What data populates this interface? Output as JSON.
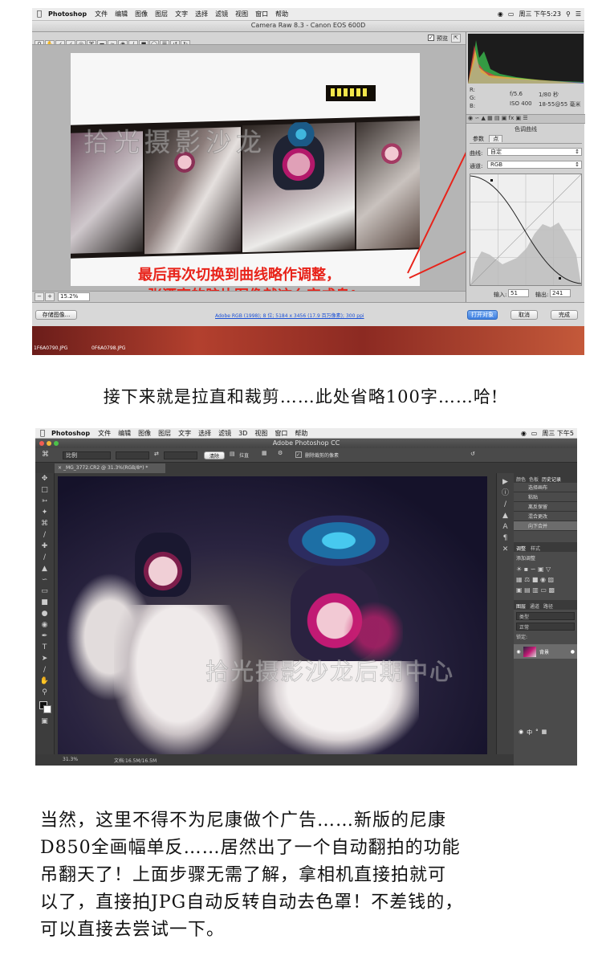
{
  "screenshot1": {
    "menubar": {
      "app": "Photoshop",
      "items": [
        "文件",
        "编辑",
        "图像",
        "图层",
        "文字",
        "选择",
        "滤镜",
        "视图",
        "窗口",
        "帮助"
      ],
      "status": "周三 下午5:23"
    },
    "window_title": "Camera Raw 8.3 - Canon EOS 600D",
    "preview_label": "预览",
    "zoom": "15.2%",
    "watermark": "拾光摄影沙龙",
    "annotation_line1": "最后再次切换到曲线略作调整，",
    "annotation_line2": "一张漂亮的胶片图像就这么完成鸟!",
    "camera_info": {
      "r_label": "R:",
      "g_label": "G:",
      "b_label": "B:",
      "aperture": "f/5.6",
      "shutter": "1/80 秒",
      "iso": "ISO 400",
      "lens": "18-55@55 毫米"
    },
    "panel_title": "色调曲线",
    "curve_tabs": [
      "参数",
      "点"
    ],
    "curve_label": "曲线:",
    "curve_value": "自定",
    "channel_label": "通道:",
    "channel_value": "RGB",
    "input_label": "输入:",
    "input_value": "51",
    "output_label": "输出:",
    "output_value": "241",
    "save_button": "存储图像...",
    "workflow_link": "Adobe RGB (1998); 8 位; 5184 x 3456 (17.9 百万像素); 300 ppi",
    "open_button": "打开对象",
    "cancel_button": "取消",
    "done_button": "完成",
    "dock_files": [
      "1F6A0790.JPG",
      "0F6A0798.JPG"
    ]
  },
  "paragraph1": "接下来就是拉直和裁剪……此处省略100字……哈!",
  "screenshot2": {
    "menubar": {
      "app": "Photoshop",
      "items": [
        "文件",
        "编辑",
        "图像",
        "图层",
        "文字",
        "选择",
        "滤镜",
        "3D",
        "视图",
        "窗口",
        "帮助"
      ],
      "status": "周三 下午5"
    },
    "window_title": "Adobe Photoshop CC",
    "options": {
      "ratio": "比例",
      "clear_button": "清除",
      "straighten": "拉直",
      "delete_crop": "删除裁剪的像素"
    },
    "doc_tab": "_MG_3772.CR2 @ 31.3%(RGB/8*) *",
    "watermark": "拾光摄影沙龙后期中心",
    "status_zoom": "31.3%",
    "status_doc": "文档:16.5M/16.5M",
    "panel_tabs": [
      "颜色",
      "色板",
      "历史记录"
    ],
    "history_items": [
      "选择画布",
      "粘贴",
      "离反保留",
      "混合更改",
      "向下合并"
    ],
    "adjust_tabs": [
      "调整",
      "样式"
    ],
    "adjust_title": "添加调整",
    "layer_tabs": [
      "图层",
      "通道",
      "路径"
    ],
    "layer_kind": "类型",
    "layer_blend": "正常",
    "layer_lock": "锁定:",
    "layer_name": "背景",
    "ime": "中"
  },
  "paragraph2": [
    "当然，这里不得不为尼康做个广告……新版的尼康",
    "D850全画幅单反……居然出了一个自动翻拍的功能",
    "吊翻天了！上面步骤无需了解，拿相机直接拍就可",
    "以了，直接拍JPG自动反转自动去色罩！不差钱的，",
    "可以直接去尝试一下。"
  ],
  "colors": {
    "annotation_red": "#e8231a",
    "ps_dark": "#3a3a3a",
    "acr_gray": "#b8b8b8"
  }
}
